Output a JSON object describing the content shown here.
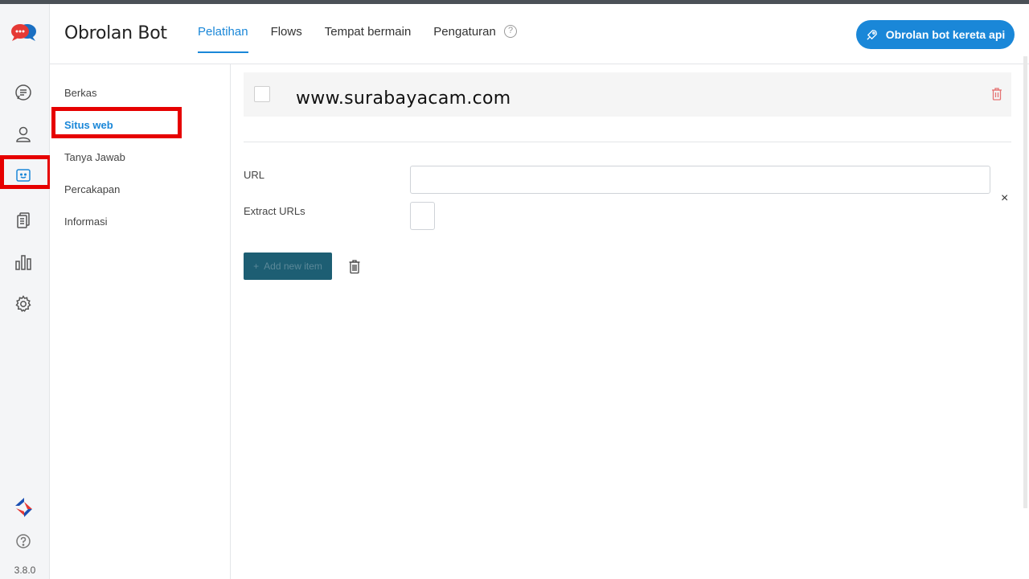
{
  "app": {
    "title": "Obrolan Bot",
    "version": "3.8.0",
    "brand_color": "#1a87d8",
    "highlight_color": "#e60000"
  },
  "rail": {
    "icons": [
      "chat-logo-icon",
      "conversations-icon",
      "user-icon",
      "bot-face-icon",
      "documents-icon",
      "analytics-icon",
      "settings-icon",
      "brand-logo-icon",
      "help-icon"
    ]
  },
  "header": {
    "tabs": [
      {
        "label": "Pelatihan",
        "active": true
      },
      {
        "label": "Flows",
        "active": false
      },
      {
        "label": "Tempat bermain",
        "active": false
      },
      {
        "label": "Pengaturan",
        "active": false
      }
    ],
    "help_glyph": "?",
    "train_button": "Obrolan bot kereta api"
  },
  "subnav": {
    "items": [
      {
        "label": "Berkas",
        "active": false
      },
      {
        "label": "Situs web",
        "active": true
      },
      {
        "label": "Tanya Jawab",
        "active": false
      },
      {
        "label": "Percakapan",
        "active": false
      },
      {
        "label": "Informasi",
        "active": false
      }
    ]
  },
  "main": {
    "website_row": {
      "url": "www.surabayacam.com"
    },
    "form": {
      "url_label": "URL",
      "url_value": "",
      "extract_label": "Extract URLs",
      "close_glyph": "×"
    },
    "add_button": {
      "icon": "+",
      "label": "Add new item"
    }
  }
}
